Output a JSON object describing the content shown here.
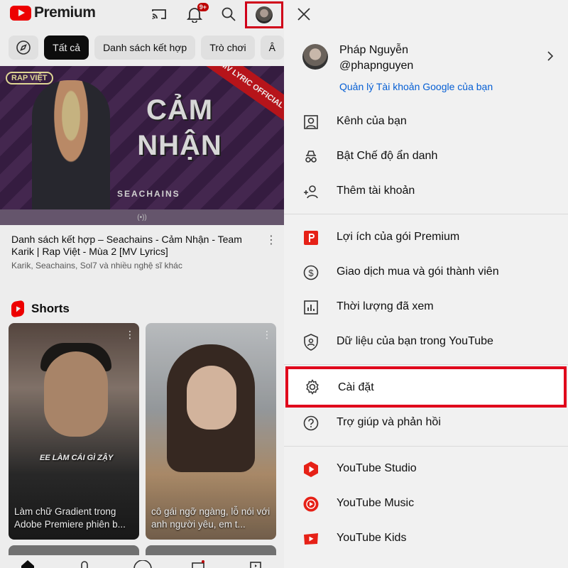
{
  "header": {
    "logo_text": "Premium",
    "notification_count": "9+"
  },
  "chips": [
    {
      "label": "Tất cả"
    },
    {
      "label": "Danh sách kết hợp"
    },
    {
      "label": "Trò chơi"
    },
    {
      "label": "Â"
    }
  ],
  "featured_video": {
    "title": "Danh sách kết hợp – Seachains - Cảm Nhận - Team Karik | Rap Việt - Mùa 2  [MV Lyrics]",
    "meta": "Karik, Seachains, Sol7 và nhiều nghệ sĩ khác",
    "thumb_title_line1": "CẢM",
    "thumb_title_line2": "NHẬN",
    "thumb_artist": "SEACHAINS",
    "thumb_badge": "RAP VIỆT",
    "thumb_corner": "MV LYRIC OFFICIAL",
    "thumb_live": "(•))"
  },
  "shorts": {
    "heading": "Shorts",
    "items": [
      {
        "title": "Làm chữ Gradient trong Adobe Premiere phiên b...",
        "caption": "EE LÀM CÁI GÌ ZẬY"
      },
      {
        "title": "cô gái ngỡ ngàng, lỗ nói với anh người yêu, em t..."
      }
    ]
  },
  "account": {
    "name": "Pháp Nguyễn",
    "handle": "@phapnguyen",
    "manage_link": "Quản lý Tài khoản Google của bạn"
  },
  "menu": {
    "group1": [
      {
        "label": "Kênh của bạn",
        "icon": "person-box-icon"
      },
      {
        "label": "Bật Chế độ ẩn danh",
        "icon": "incognito-icon"
      },
      {
        "label": "Thêm tài khoản",
        "icon": "add-person-icon"
      }
    ],
    "group2": [
      {
        "label": "Lợi ích của gói Premium",
        "icon": "premium-icon"
      },
      {
        "label": "Giao dịch mua và gói thành viên",
        "icon": "dollar-icon"
      },
      {
        "label": "Thời lượng đã xem",
        "icon": "bar-chart-icon"
      },
      {
        "label": "Dữ liệu của bạn trong YouTube",
        "icon": "shield-person-icon"
      }
    ],
    "group3": [
      {
        "label": "Cài đặt",
        "icon": "gear-icon"
      },
      {
        "label": "Trợ giúp và phản hồi",
        "icon": "help-icon"
      }
    ],
    "group4": [
      {
        "label": "YouTube Studio",
        "icon": "youtube-studio-icon"
      },
      {
        "label": "YouTube Music",
        "icon": "youtube-music-icon"
      },
      {
        "label": "YouTube Kids",
        "icon": "youtube-kids-icon"
      }
    ]
  },
  "colors": {
    "brand_red": "#ff0000",
    "highlight_border": "#e0001b",
    "link_blue": "#065fd4"
  }
}
